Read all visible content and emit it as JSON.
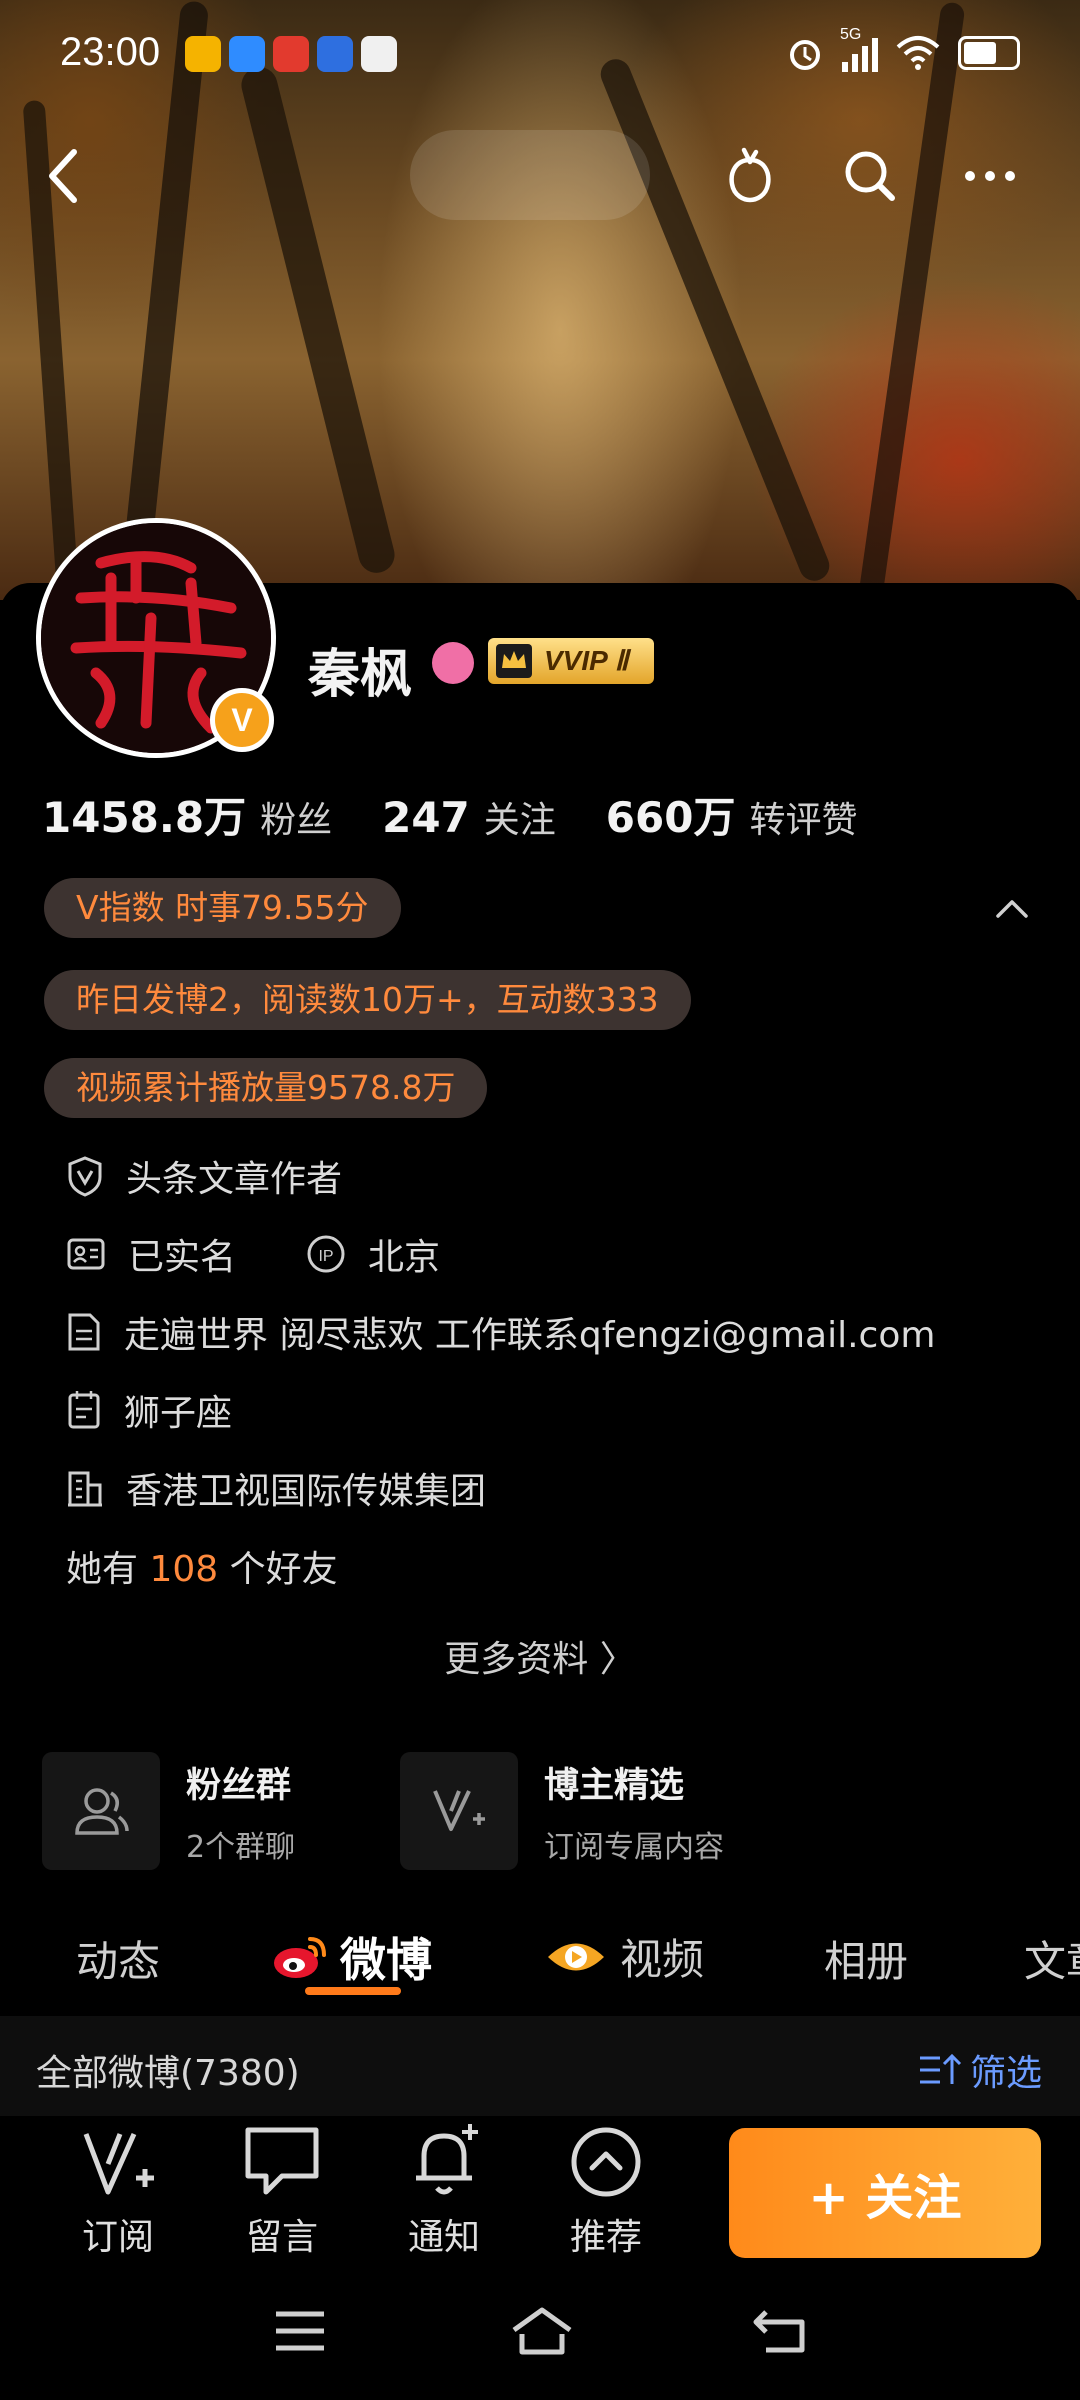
{
  "status_bar": {
    "time": "23:00",
    "network": "5G"
  },
  "profile": {
    "name": "秦枫",
    "vip_label": "VVIP Ⅱ",
    "verified_badge": "V",
    "stats": [
      {
        "value": "1458.8万",
        "label": "粉丝"
      },
      {
        "value": "247",
        "label": "关注"
      },
      {
        "value": "660万",
        "label": "转评赞"
      }
    ],
    "pills": {
      "v_index": "V指数 时事79.55分",
      "yesterday": "昨日发博2，阅读数10万+，互动数333",
      "video": "视频累计播放量9578.8万"
    },
    "info": {
      "author": "头条文章作者",
      "real_name": "已实名",
      "ip_location": "北京",
      "bio": "走遍世界 阅尽悲欢 工作联系qfengzi@gmail.com",
      "zodiac": "狮子座",
      "company": "香港卫视国际传媒集团"
    },
    "friends": {
      "prefix": "她有 ",
      "count": "108",
      "suffix": " 个好友"
    },
    "more_info": "更多资料 〉"
  },
  "features": [
    {
      "title": "粉丝群",
      "subtitle": "2个群聊"
    },
    {
      "title": "博主精选",
      "subtitle": "订阅专属内容"
    }
  ],
  "tabs": [
    "动态",
    "微博",
    "视频",
    "相册",
    "文章"
  ],
  "filter": {
    "all_posts": "全部微博(7380)",
    "filter_label": "筛选"
  },
  "bottom_bar": {
    "items": [
      "订阅",
      "留言",
      "通知",
      "推荐"
    ],
    "follow": "+ 关注"
  },
  "colors": {
    "accent": "#ff7a1a",
    "pill_bg": "#3d3330",
    "pill_text": "#ff8a3d",
    "filter_blue": "#6b9bff"
  }
}
